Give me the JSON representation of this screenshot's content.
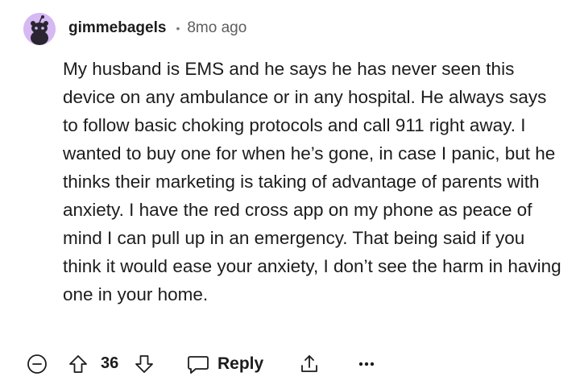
{
  "comment": {
    "username": "gimmebagels",
    "separator": "•",
    "timestamp": "8mo ago",
    "body": "My husband is EMS and he says he has never seen this device on any ambulance or in any hospital. He always says to follow basic choking protocols and call 911 right away. I wanted to buy one for when he’s gone, in case I panic, but he thinks their marketing is taking of advantage of parents with anxiety. I have the red cross app on my phone as peace of mind I can pull up in an emergency. That being said if you think it would ease your anxiety, I don’t see the harm in having one in your home.",
    "avatar_color": "#d6b8f3"
  },
  "actions": {
    "score": "36",
    "reply_label": "Reply",
    "icons": [
      "collapse-icon",
      "upvote-icon",
      "downvote-icon",
      "reply-icon",
      "share-icon",
      "more-icon"
    ]
  }
}
